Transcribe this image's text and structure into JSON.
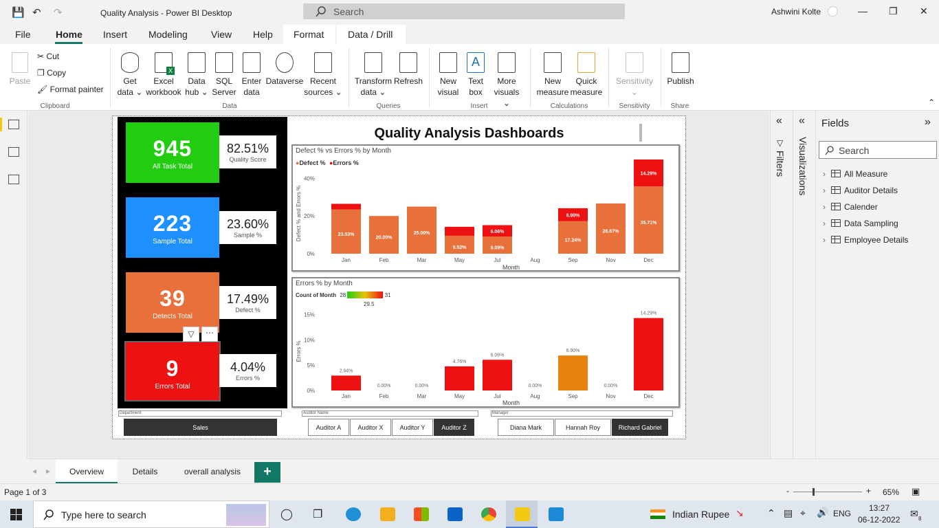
{
  "window": {
    "title": "Quality Analysis - Power BI Desktop",
    "search_placeholder": "Search",
    "user": "Ashwini Kolte"
  },
  "ribbon_tabs": [
    "File",
    "Home",
    "Insert",
    "Modeling",
    "View",
    "Help",
    "Format",
    "Data / Drill"
  ],
  "ribbon": {
    "clipboard": {
      "paste": "Paste",
      "cut": "Cut",
      "copy": "Copy",
      "format_painter": "Format painter",
      "group": "Clipboard"
    },
    "data": {
      "get_data": [
        "Get",
        "data"
      ],
      "excel": [
        "Excel",
        "workbook"
      ],
      "data_hub": [
        "Data",
        "hub"
      ],
      "sql": [
        "SQL",
        "Server"
      ],
      "enter": [
        "Enter",
        "data"
      ],
      "dataverse": [
        "Dataverse",
        ""
      ],
      "recent": [
        "Recent",
        "sources"
      ],
      "group": "Data"
    },
    "queries": {
      "transform": [
        "Transform",
        "data"
      ],
      "refresh": [
        "Refresh",
        ""
      ],
      "group": "Queries"
    },
    "insert": {
      "new_visual": [
        "New",
        "visual"
      ],
      "text_box": [
        "Text",
        "box"
      ],
      "more_visuals": [
        "More",
        "visuals"
      ],
      "group": "Insert"
    },
    "calculations": {
      "new_measure": [
        "New",
        "measure"
      ],
      "quick_measure": [
        "Quick",
        "measure"
      ],
      "group": "Calculations"
    },
    "sensitivity": {
      "label": "Sensitivity",
      "group": "Sensitivity"
    },
    "share": {
      "publish": "Publish",
      "group": "Share"
    }
  },
  "kpis": [
    {
      "value": "945",
      "label": "All Task Total",
      "color": "#22cc11",
      "pct": "82.51%",
      "pct_label": "Quality Score"
    },
    {
      "value": "223",
      "label": "Sample Total",
      "color": "#1e90ff",
      "pct": "23.60%",
      "pct_label": "Sample %"
    },
    {
      "value": "39",
      "label": "Detects Total",
      "color": "#e8703a",
      "pct": "17.49%",
      "pct_label": "Defect %"
    },
    {
      "value": "9",
      "label": "Errors Total",
      "color": "#ee1111",
      "pct": "4.04%",
      "pct_label": "Errors %"
    }
  ],
  "dashboard_title": "Quality Analysis Dashboards",
  "chart_data": [
    {
      "type": "bar",
      "title": "Defect % vs Errors % by Month",
      "categories": [
        "Jan",
        "Feb",
        "Mar",
        "May",
        "Jul",
        "Aug",
        "Sep",
        "Nov",
        "Dec"
      ],
      "series": [
        {
          "name": "Defect %",
          "values": [
            23.53,
            20.0,
            25.0,
            9.52,
            9.09,
            0,
            17.24,
            26.67,
            35.71
          ],
          "labels": [
            "23.53%",
            "20.00%",
            "25.00%",
            "9.52%",
            "9.09%",
            "",
            "17.24%",
            "26.67%",
            "35.71%"
          ],
          "color": "#e8703a"
        },
        {
          "name": "Errors %",
          "values": [
            2.94,
            0,
            0,
            4.76,
            6.06,
            0,
            6.9,
            0,
            14.29
          ],
          "labels": [
            "",
            "",
            "",
            "",
            "6.06%",
            "",
            "6.90%",
            "",
            "14.29%"
          ],
          "color": "#ee1111"
        }
      ],
      "stacked": true,
      "xlabel": "Month",
      "ylabel": "Defect % and Errors %",
      "yticks": [
        "0%",
        "20%",
        "40%"
      ],
      "ylim": [
        0,
        50
      ],
      "legend": "top-left"
    },
    {
      "type": "bar",
      "title": "Errors % by Month",
      "categories": [
        "Jan",
        "Feb",
        "Mar",
        "May",
        "Jul",
        "Aug",
        "Sep",
        "Nov",
        "Dec"
      ],
      "values": [
        2.94,
        0,
        0,
        4.76,
        6.06,
        0,
        6.9,
        0,
        14.29
      ],
      "labels": [
        "2.94%",
        "0.00%",
        "0.00%",
        "4.76%",
        "6.06%",
        "0.00%",
        "6.90%",
        "0.00%",
        "14.29%"
      ],
      "bar_colors": [
        "#ee1111",
        "#ee1111",
        "#ee1111",
        "#ee1111",
        "#ee1111",
        "#ee1111",
        "#e8820c",
        "#ee1111",
        "#ee1111"
      ],
      "xlabel": "Month",
      "ylabel": "Errors %",
      "yticks": [
        "0%",
        "5%",
        "10%",
        "15%"
      ],
      "ylim": [
        0,
        16
      ],
      "color_scale": {
        "label": "Count of Month",
        "min": "28",
        "mid": "29.5",
        "max": "31"
      }
    }
  ],
  "slicers": {
    "department": {
      "header": "Department",
      "buttons": [
        {
          "label": "Sales",
          "selected": true
        }
      ]
    },
    "auditor": {
      "header": "Auditor Name",
      "buttons": [
        {
          "label": "Auditor A",
          "selected": false
        },
        {
          "label": "Auditor X",
          "selected": false
        },
        {
          "label": "Auditor Y",
          "selected": false
        },
        {
          "label": "Auditor Z",
          "selected": true
        }
      ]
    },
    "manager": {
      "header": "Manager",
      "buttons": [
        {
          "label": "Diana Mark",
          "selected": false
        },
        {
          "label": "Hannah Roy",
          "selected": false
        },
        {
          "label": "Richard Gabriel",
          "selected": true
        }
      ]
    }
  },
  "panes": {
    "filters": "Filters",
    "visualizations": "Visualizations",
    "fields": {
      "title": "Fields",
      "search_placeholder": "Search",
      "tables": [
        "All Measure",
        "Auditor Details",
        "Calender",
        "Data Sampling",
        "Employee Details"
      ]
    }
  },
  "page_tabs": [
    "Overview",
    "Details",
    "overall analysis"
  ],
  "add_page": "+",
  "status": {
    "page": "Page 1 of 3",
    "zoom": "65%"
  },
  "taskbar": {
    "search_placeholder": "Type here to search",
    "currency": "Indian Rupee",
    "lang": "ENG",
    "time": "13:27",
    "date": "06-12-2022",
    "notifications": "8"
  }
}
